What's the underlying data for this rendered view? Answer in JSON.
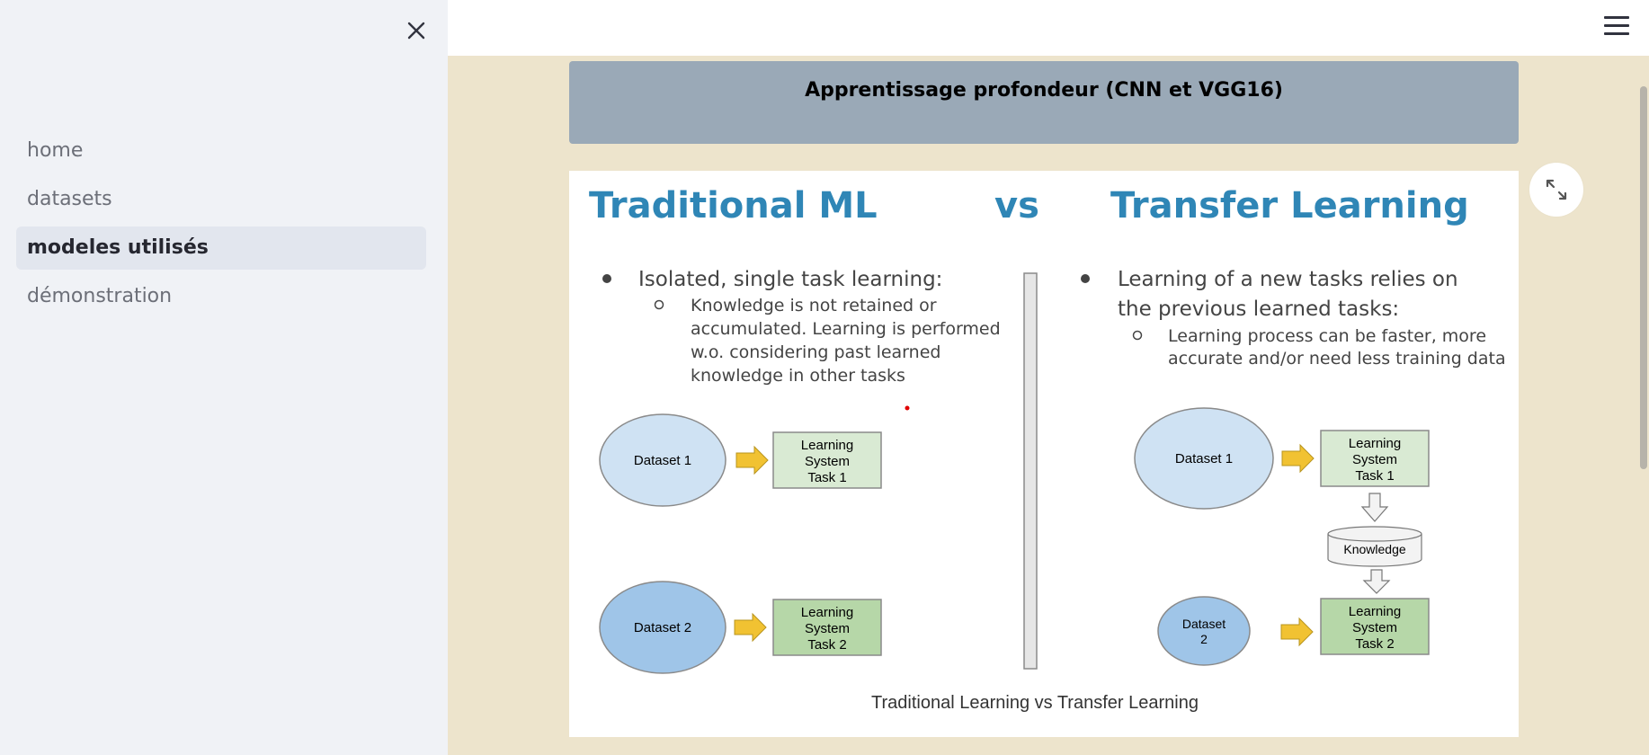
{
  "sidebar": {
    "nav": [
      {
        "label": "home",
        "active": false
      },
      {
        "label": "datasets",
        "active": false
      },
      {
        "label": "modeles utilisés",
        "active": true
      },
      {
        "label": "démonstration",
        "active": false
      }
    ]
  },
  "main": {
    "title": "Apprentissage profondeur (CNN et VGG16)",
    "figure": {
      "left_title": "Traditional ML",
      "vs": "vs",
      "right_title": "Transfer Learning",
      "left_bullet": "Isolated, single task learning:",
      "left_sub": [
        "Knowledge is not retained or",
        "accumulated. Learning is performed",
        "w.o. considering past learned",
        "knowledge in other tasks"
      ],
      "right_bullet": [
        "Learning of a new tasks relies on",
        "the previous learned tasks:"
      ],
      "right_sub": [
        "Learning process can be faster, more",
        "accurate and/or need less training data"
      ],
      "left_dataset1": "Dataset 1",
      "left_dataset2": "Dataset 2",
      "ls1": [
        "Learning",
        "System",
        "Task 1"
      ],
      "ls2": [
        "Learning",
        "System",
        "Task 2"
      ],
      "right_dataset1": "Dataset 1",
      "right_dataset2": [
        "Dataset",
        "2"
      ],
      "knowledge": "Knowledge",
      "caption": "Traditional Learning vs Transfer Learning"
    }
  },
  "icons": {
    "close": "close-icon",
    "menu": "hamburger-menu-icon",
    "expand": "fullscreen-expand-icon"
  }
}
